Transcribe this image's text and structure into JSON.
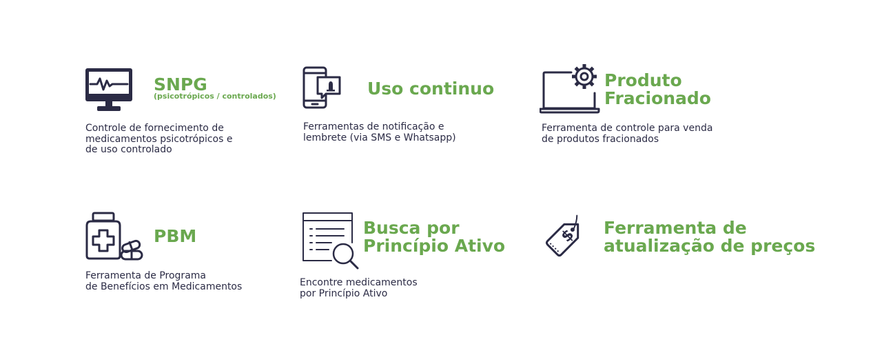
{
  "colors": {
    "accent": "#6aa84f",
    "text": "#2b2b45",
    "background": "#ffffff"
  },
  "features": [
    {
      "icon": "monitor-heartbeat-icon",
      "title": "SNPG",
      "subtitle": "(psicotrópicos / controlados)",
      "description": "Controle de fornecimento de\nmedicamentos psicotrópicos e\nde uso controlado"
    },
    {
      "icon": "smartphone-notification-icon",
      "title": "Uso continuo",
      "description": "Ferramentas de notificação e\nlembrete (via SMS e Whatsapp)"
    },
    {
      "icon": "laptop-gear-icon",
      "title_line1": "Produto",
      "title_line2": "Fracionado",
      "description": "Ferramenta de controle para venda\nde produtos fracionados"
    },
    {
      "icon": "medicine-bottle-pills-icon",
      "title": "PBM",
      "description": "Ferramenta de Programa\nde Benefícios em Medicamentos"
    },
    {
      "icon": "document-search-icon",
      "title_line1": "Busca por",
      "title_line2": "Princípio Ativo",
      "description": "Encontre medicamentos\npor Princípio Ativo"
    },
    {
      "icon": "price-tag-dollar-icon",
      "title_line1": "Ferramenta de",
      "title_line2": "atualização de preços"
    }
  ]
}
